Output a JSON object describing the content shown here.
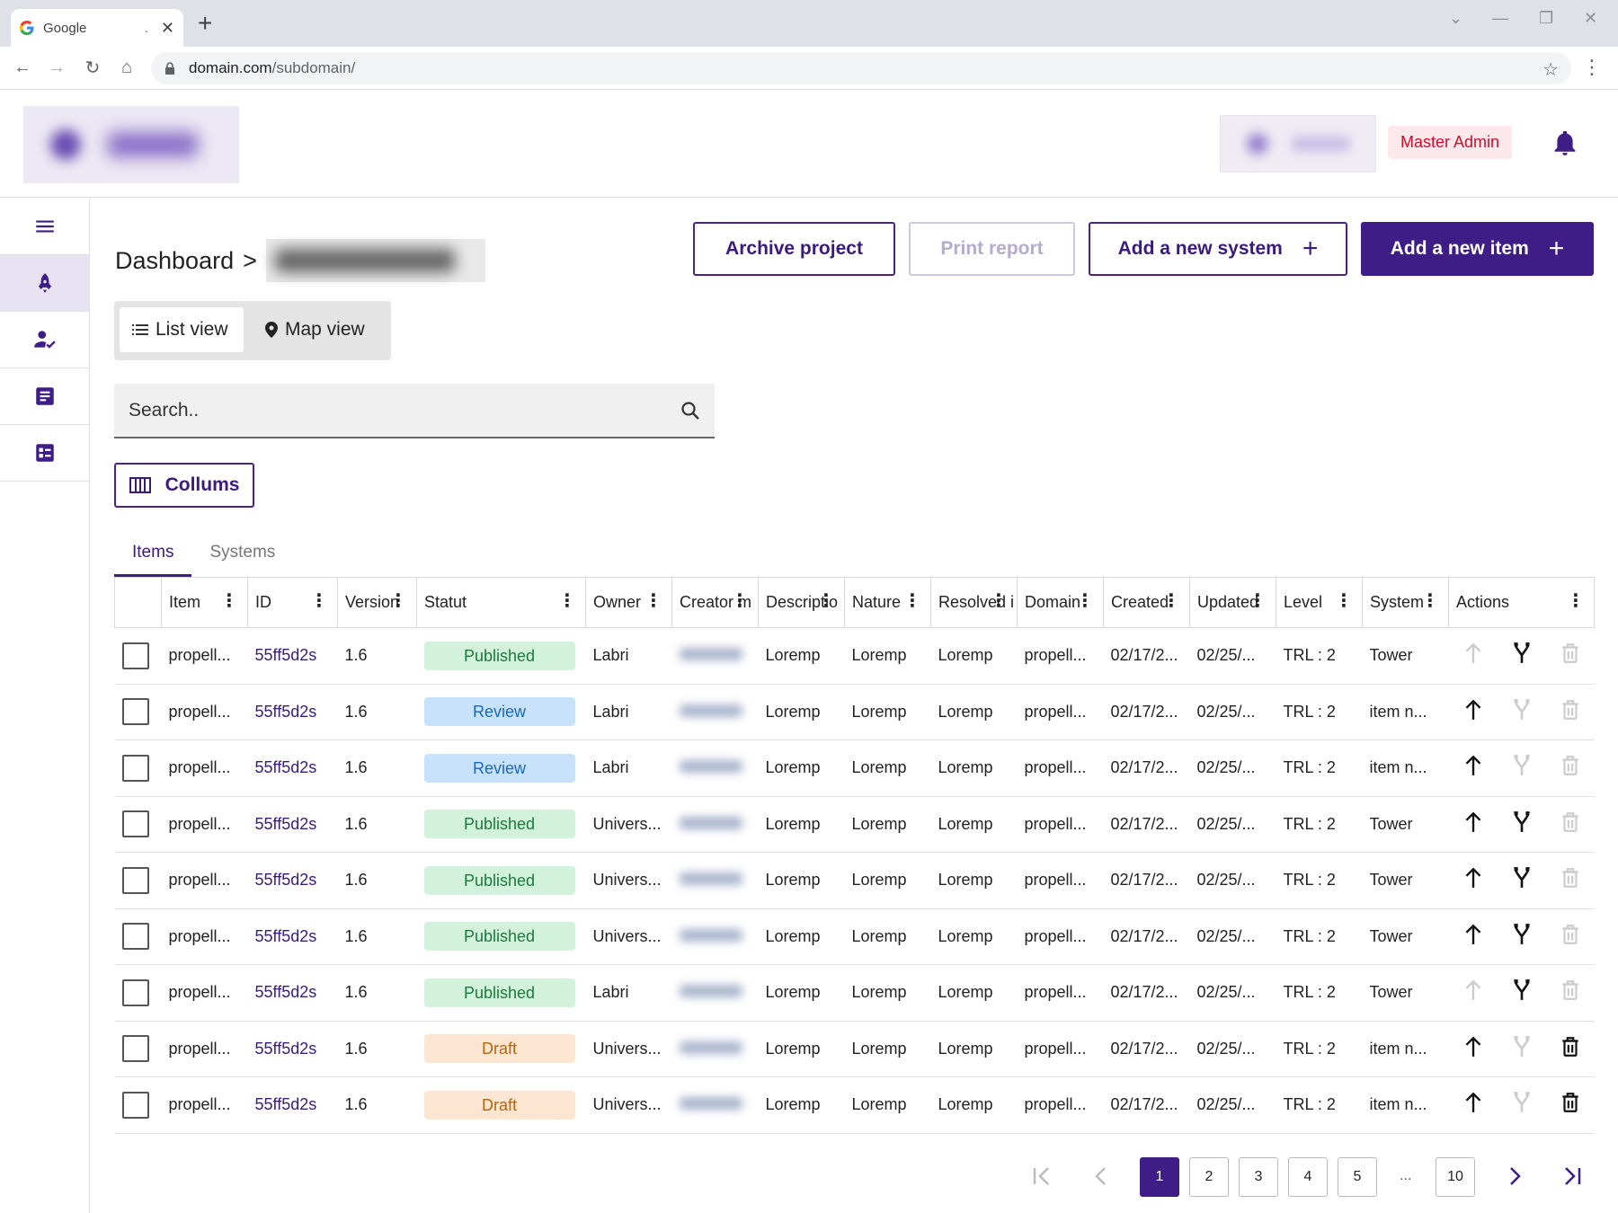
{
  "browser": {
    "tab_title": "Google",
    "tab_dot": ".",
    "url_domain": "domain.com",
    "url_path": "/subdomain/"
  },
  "header": {
    "role_badge": "Master Admin"
  },
  "breadcrumb": {
    "root": "Dashboard",
    "separator": ">"
  },
  "actions": {
    "archive": "Archive project",
    "print": "Print report",
    "add_system": "Add a new system",
    "add_item": "Add a new item"
  },
  "view_toggle": {
    "list": "List view",
    "map": "Map view"
  },
  "search": {
    "placeholder": "Search.."
  },
  "columns_button": "Collums",
  "tabs": {
    "items": "Items",
    "systems": "Systems"
  },
  "table": {
    "headers": [
      "Item",
      "ID",
      "Version",
      "Statut",
      "Owner",
      "Creator m",
      "Descriptio",
      "Nature",
      "Resolved i",
      "Domain",
      "Created",
      "Updated",
      "Level",
      "System",
      "Actions"
    ],
    "rows": [
      {
        "item": "propell...",
        "id": "55ff5d2s",
        "version": "1.6",
        "status": "Published",
        "owner": "Labri",
        "desc": "Loremp",
        "nature": "Loremp",
        "resolved": "Loremp",
        "domain": "propell...",
        "created": "02/17/2...",
        "updated": "02/25/...",
        "level": "TRL : 2",
        "system": "Tower",
        "up_enabled": false,
        "fork_enabled": true,
        "delete_enabled": false
      },
      {
        "item": "propell...",
        "id": "55ff5d2s",
        "version": "1.6",
        "status": "Review",
        "owner": "Labri",
        "desc": "Loremp",
        "nature": "Loremp",
        "resolved": "Loremp",
        "domain": "propell...",
        "created": "02/17/2...",
        "updated": "02/25/...",
        "level": "TRL : 2",
        "system": "item n...",
        "up_enabled": true,
        "fork_enabled": false,
        "delete_enabled": false
      },
      {
        "item": "propell...",
        "id": "55ff5d2s",
        "version": "1.6",
        "status": "Review",
        "owner": "Labri",
        "desc": "Loremp",
        "nature": "Loremp",
        "resolved": "Loremp",
        "domain": "propell...",
        "created": "02/17/2...",
        "updated": "02/25/...",
        "level": "TRL : 2",
        "system": "item n...",
        "up_enabled": true,
        "fork_enabled": false,
        "delete_enabled": false
      },
      {
        "item": "propell...",
        "id": "55ff5d2s",
        "version": "1.6",
        "status": "Published",
        "owner": "Univers...",
        "desc": "Loremp",
        "nature": "Loremp",
        "resolved": "Loremp",
        "domain": "propell...",
        "created": "02/17/2...",
        "updated": "02/25/...",
        "level": "TRL : 2",
        "system": "Tower",
        "up_enabled": true,
        "fork_enabled": true,
        "delete_enabled": false
      },
      {
        "item": "propell...",
        "id": "55ff5d2s",
        "version": "1.6",
        "status": "Published",
        "owner": "Univers...",
        "desc": "Loremp",
        "nature": "Loremp",
        "resolved": "Loremp",
        "domain": "propell...",
        "created": "02/17/2...",
        "updated": "02/25/...",
        "level": "TRL : 2",
        "system": "Tower",
        "up_enabled": true,
        "fork_enabled": true,
        "delete_enabled": false
      },
      {
        "item": "propell...",
        "id": "55ff5d2s",
        "version": "1.6",
        "status": "Published",
        "owner": "Univers...",
        "desc": "Loremp",
        "nature": "Loremp",
        "resolved": "Loremp",
        "domain": "propell...",
        "created": "02/17/2...",
        "updated": "02/25/...",
        "level": "TRL : 2",
        "system": "Tower",
        "up_enabled": true,
        "fork_enabled": true,
        "delete_enabled": false
      },
      {
        "item": "propell...",
        "id": "55ff5d2s",
        "version": "1.6",
        "status": "Published",
        "owner": "Labri",
        "desc": "Loremp",
        "nature": "Loremp",
        "resolved": "Loremp",
        "domain": "propell...",
        "created": "02/17/2...",
        "updated": "02/25/...",
        "level": "TRL : 2",
        "system": "Tower",
        "up_enabled": false,
        "fork_enabled": true,
        "delete_enabled": false
      },
      {
        "item": "propell...",
        "id": "55ff5d2s",
        "version": "1.6",
        "status": "Draft",
        "owner": "Univers...",
        "desc": "Loremp",
        "nature": "Loremp",
        "resolved": "Loremp",
        "domain": "propell...",
        "created": "02/17/2...",
        "updated": "02/25/...",
        "level": "TRL : 2",
        "system": "item n...",
        "up_enabled": true,
        "fork_enabled": false,
        "delete_enabled": true
      },
      {
        "item": "propell...",
        "id": "55ff5d2s",
        "version": "1.6",
        "status": "Draft",
        "owner": "Univers...",
        "desc": "Loremp",
        "nature": "Loremp",
        "resolved": "Loremp",
        "domain": "propell...",
        "created": "02/17/2...",
        "updated": "02/25/...",
        "level": "TRL : 2",
        "system": "item n...",
        "up_enabled": true,
        "fork_enabled": false,
        "delete_enabled": true
      }
    ]
  },
  "pagination": {
    "pages": [
      "1",
      "2",
      "3",
      "4",
      "5"
    ],
    "ellipsis": "...",
    "last_page": "10",
    "current": "1"
  },
  "colors": {
    "brand": "#3f1d86",
    "published_bg": "#d3f2dc",
    "review_bg": "#c9e2fb",
    "draft_bg": "#fde6d1",
    "admin_badge_text": "#c8102e"
  }
}
